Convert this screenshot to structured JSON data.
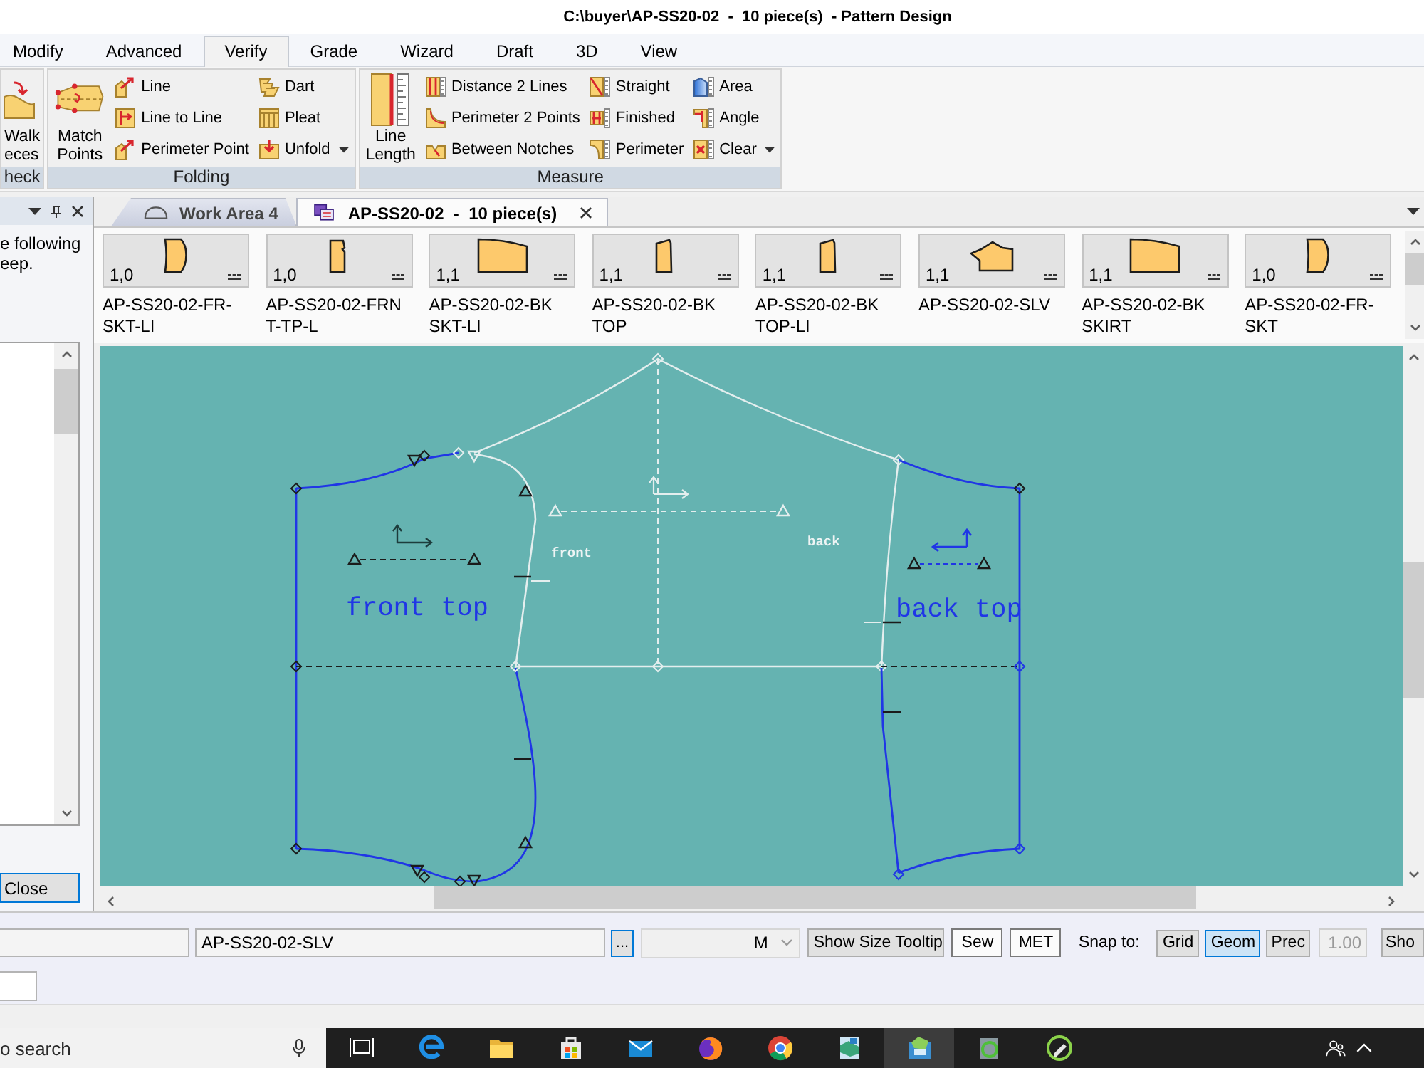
{
  "window": {
    "title": "C:\\buyer\\AP-SS20-02  -  10 piece(s)  - Pattern Design"
  },
  "ribbon": {
    "tabs": [
      {
        "label": "Modify",
        "selected": false
      },
      {
        "label": "Advanced",
        "selected": false
      },
      {
        "label": "Verify",
        "selected": true
      },
      {
        "label": "Grade",
        "selected": false
      },
      {
        "label": "Wizard",
        "selected": false
      },
      {
        "label": "Draft",
        "selected": false
      },
      {
        "label": "3D",
        "selected": false
      },
      {
        "label": "View",
        "selected": false
      }
    ],
    "groups": [
      {
        "label": "heck",
        "large_buttons": [
          {
            "lines": [
              "Walk",
              "eces"
            ],
            "kind": "walk-pieces"
          }
        ]
      },
      {
        "label": "Folding",
        "large_buttons": [
          {
            "lines": [
              "Match",
              "Points"
            ],
            "kind": "match-points"
          }
        ],
        "columns": [
          [
            {
              "label": "Line",
              "kind": "line",
              "dropdown": false
            },
            {
              "label": "Line to Line",
              "kind": "line-to-line",
              "dropdown": false
            },
            {
              "label": "Perimeter Point",
              "kind": "perimeter-point",
              "dropdown": false
            }
          ],
          [
            {
              "label": "Dart",
              "kind": "dart",
              "dropdown": false
            },
            {
              "label": "Pleat",
              "kind": "pleat",
              "dropdown": false
            },
            {
              "label": "Unfold",
              "kind": "unfold",
              "dropdown": true
            }
          ]
        ]
      },
      {
        "label": "Measure",
        "large_buttons": [
          {
            "lines": [
              "Line",
              "Length"
            ],
            "kind": "line-length"
          }
        ],
        "columns": [
          [
            {
              "label": "Distance 2 Lines",
              "kind": "distance-2-lines",
              "dropdown": false
            },
            {
              "label": "Perimeter 2 Points",
              "kind": "perimeter-2-points",
              "dropdown": false
            },
            {
              "label": "Between Notches",
              "kind": "between-notches",
              "dropdown": false
            }
          ],
          [
            {
              "label": "Straight",
              "kind": "straight",
              "dropdown": false
            },
            {
              "label": "Finished",
              "kind": "finished",
              "dropdown": false
            },
            {
              "label": "Perimeter",
              "kind": "perimeter",
              "dropdown": false
            }
          ],
          [
            {
              "label": "Area",
              "kind": "area",
              "dropdown": false
            },
            {
              "label": "Angle",
              "kind": "angle",
              "dropdown": false
            },
            {
              "label": "Clear",
              "kind": "clear",
              "dropdown": true
            }
          ]
        ]
      }
    ]
  },
  "side_panel": {
    "lines": [
      "e following",
      "eep."
    ],
    "close_button": "Close"
  },
  "documents": {
    "tabs": [
      {
        "label": "Work Area 4",
        "kind": "work-area",
        "selected": false,
        "closable": false
      },
      {
        "label": "AP-SS20-02  -  10 piece(s)",
        "kind": "piece-set",
        "selected": true,
        "closable": true
      }
    ]
  },
  "pieces": [
    {
      "grade": "1,0",
      "name": "AP-SS20-02-FR-SKT-LI",
      "kind": "front-skirt"
    },
    {
      "grade": "1,0",
      "name": "AP-SS20-02-FRNT-TP-L",
      "kind": "front-top"
    },
    {
      "grade": "1,1",
      "name": "AP-SS20-02-BK SKT-LI",
      "kind": "back-skirt"
    },
    {
      "grade": "1,1",
      "name": "AP-SS20-02-BK TOP",
      "kind": "back-top"
    },
    {
      "grade": "1,1",
      "name": "AP-SS20-02-BK TOP-LI",
      "kind": "back-top"
    },
    {
      "grade": "1,1",
      "name": "AP-SS20-02-SLV",
      "kind": "sleeve"
    },
    {
      "grade": "1,1",
      "name": "AP-SS20-02-BK SKIRT",
      "kind": "back-skirt"
    },
    {
      "grade": "1,0",
      "name": "AP-SS20-02-FR-SKT",
      "kind": "front-skirt"
    }
  ],
  "canvas": {
    "front_piece": {
      "label": "front top"
    },
    "sleeve": {
      "front_label": "front",
      "back_label": "back"
    },
    "back_piece": {
      "label": "back top"
    }
  },
  "bottom_bar": {
    "piece_field": {
      "value": "AP-SS20-02-SLV"
    },
    "browse_button": "...",
    "size": {
      "value": "M"
    },
    "buttons": [
      {
        "label": "Show Size Tooltip",
        "kind": "push"
      },
      {
        "label": "Sew",
        "kind": "toggle"
      },
      {
        "label": "MET",
        "kind": "toggle"
      }
    ],
    "snap_label": "Snap to:",
    "snap": [
      {
        "label": "Grid",
        "selected": false
      },
      {
        "label": "Geom",
        "selected": true
      },
      {
        "label": "Prec",
        "selected": false
      }
    ],
    "precision": {
      "value": "1.00",
      "disabled": true
    },
    "cut_button": "Sho"
  },
  "taskbar": {
    "search": {
      "placeholder": "o search"
    },
    "apps": [
      {
        "kind": "task-view",
        "active": false
      },
      {
        "kind": "e-swirl",
        "active": false
      },
      {
        "kind": "folder",
        "active": false
      },
      {
        "kind": "bag",
        "active": false
      },
      {
        "kind": "envelope",
        "active": false
      },
      {
        "kind": "flame-globe",
        "active": false
      },
      {
        "kind": "ring",
        "active": false
      },
      {
        "kind": "map-app",
        "active": false
      },
      {
        "kind": "pattern-app",
        "active": true
      },
      {
        "kind": "disc-app",
        "active": false
      },
      {
        "kind": "pen-disc",
        "active": false
      }
    ],
    "tray": [
      {
        "kind": "people"
      },
      {
        "kind": "chevron"
      }
    ]
  }
}
